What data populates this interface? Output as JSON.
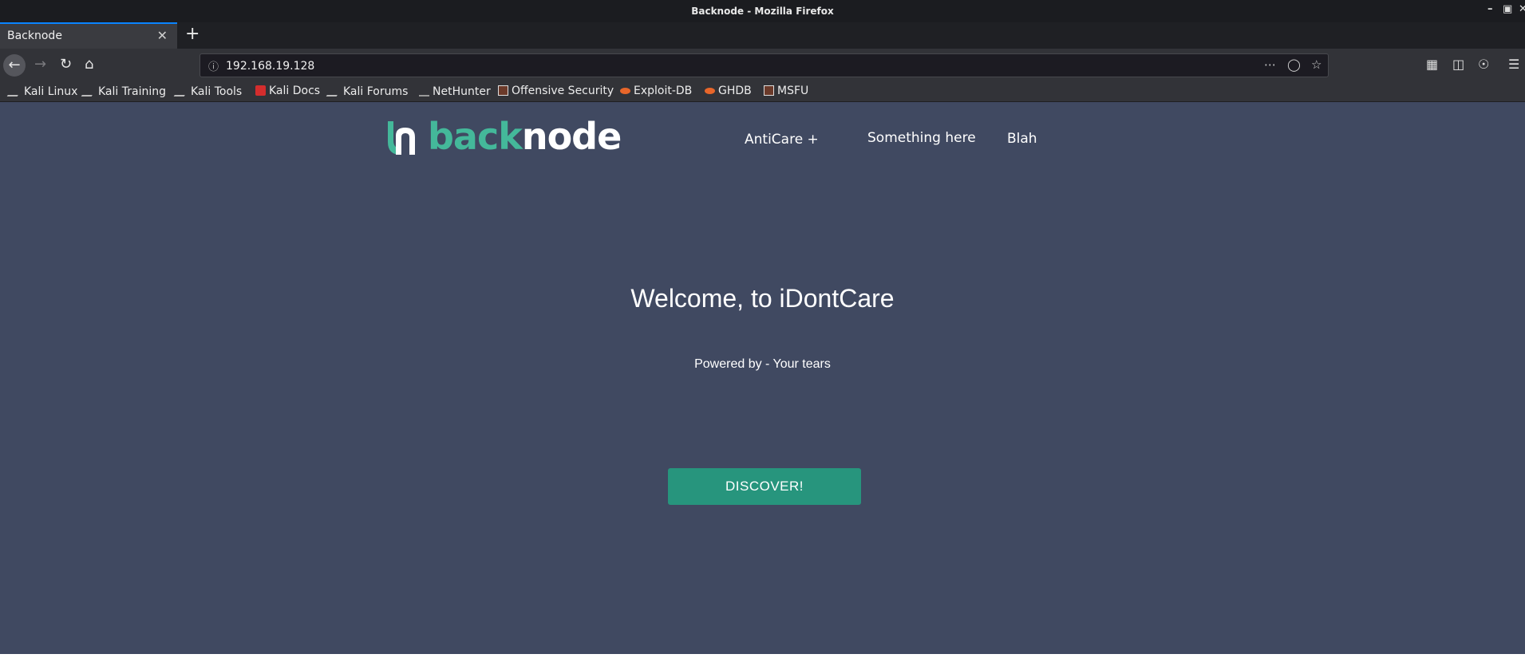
{
  "window": {
    "title": "Backnode - Mozilla Firefox"
  },
  "tab": {
    "title": "Backnode"
  },
  "address_bar": {
    "url": "192.168.19.128"
  },
  "bookmarks": [
    {
      "label": "Kali Linux",
      "icon": "kali-dragon-icon"
    },
    {
      "label": "Kali Training",
      "icon": "kali-dragon-icon"
    },
    {
      "label": "Kali Tools",
      "icon": "kali-dragon-icon"
    },
    {
      "label": "Kali Docs",
      "icon": "kali-docs-icon"
    },
    {
      "label": "Kali Forums",
      "icon": "kali-dragon-icon"
    },
    {
      "label": "NetHunter",
      "icon": "nethunter-icon"
    },
    {
      "label": "Offensive Security",
      "icon": "offsec-icon"
    },
    {
      "label": "Exploit-DB",
      "icon": "exploit-db-icon"
    },
    {
      "label": "GHDB",
      "icon": "ghdb-icon"
    },
    {
      "label": "MSFU",
      "icon": "offsec-icon"
    }
  ],
  "site": {
    "logo": {
      "part1": "back",
      "part2": "node",
      "color1": "#44b89a",
      "color2": "#ffffff"
    },
    "nav": [
      {
        "label": "AntiCare +"
      },
      {
        "label": "Something here"
      },
      {
        "label": "Blah"
      }
    ],
    "hero": {
      "heading": "Welcome, to iDontCare",
      "subtitle": "Powered by - Your tears",
      "cta": "DISCOVER!"
    }
  },
  "colors": {
    "page_bg": "#404961",
    "accent": "#27957d",
    "logo_green": "#44b89a"
  }
}
